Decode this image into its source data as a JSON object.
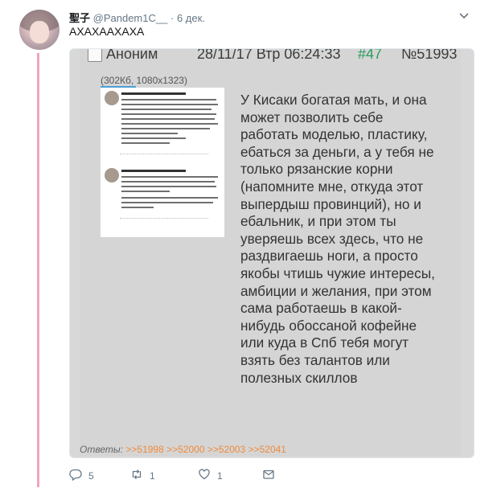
{
  "author": {
    "name": "聖子",
    "handle": "@Pandem1C__",
    "separator": "·",
    "date": "6 дек."
  },
  "tweet": {
    "text": "АХАХААХАХА"
  },
  "media": {
    "post": {
      "author": "Аноним",
      "datetime": "28/11/17 Втр 06:24:33",
      "number": "#47",
      "post_number": "№51993",
      "file_info": "(302Кб, 1080x1323)",
      "text": "У Кисаки богатая мать, и она может позволить себе работать моделью, пластику, ебаться за деньги, а у тебя не только рязанские корни (напомните мне, откуда этот выпердыш провинций), но и ебальник, и при этом ты уверяешь всех здесь, что не раздвигаешь ноги, а просто якобы чтишь чужие интересы, амбиции и желания, при этом сама работаешь в какой-нибудь обоссаной кофейне или куда в Спб тебя могут взять без талантов или полезных скиллов",
      "replies_label": "Ответы:",
      "replies": [
        ">>51998",
        ">>52000",
        ">>52003",
        ">>52041"
      ]
    }
  },
  "actions": {
    "reply_count": "5",
    "retweet_count": "1",
    "like_count": "1"
  },
  "colors": {
    "thread_line": "#f2a3c2",
    "link_orange": "#f08a3a",
    "post_number_green": "#2a9d5c"
  }
}
